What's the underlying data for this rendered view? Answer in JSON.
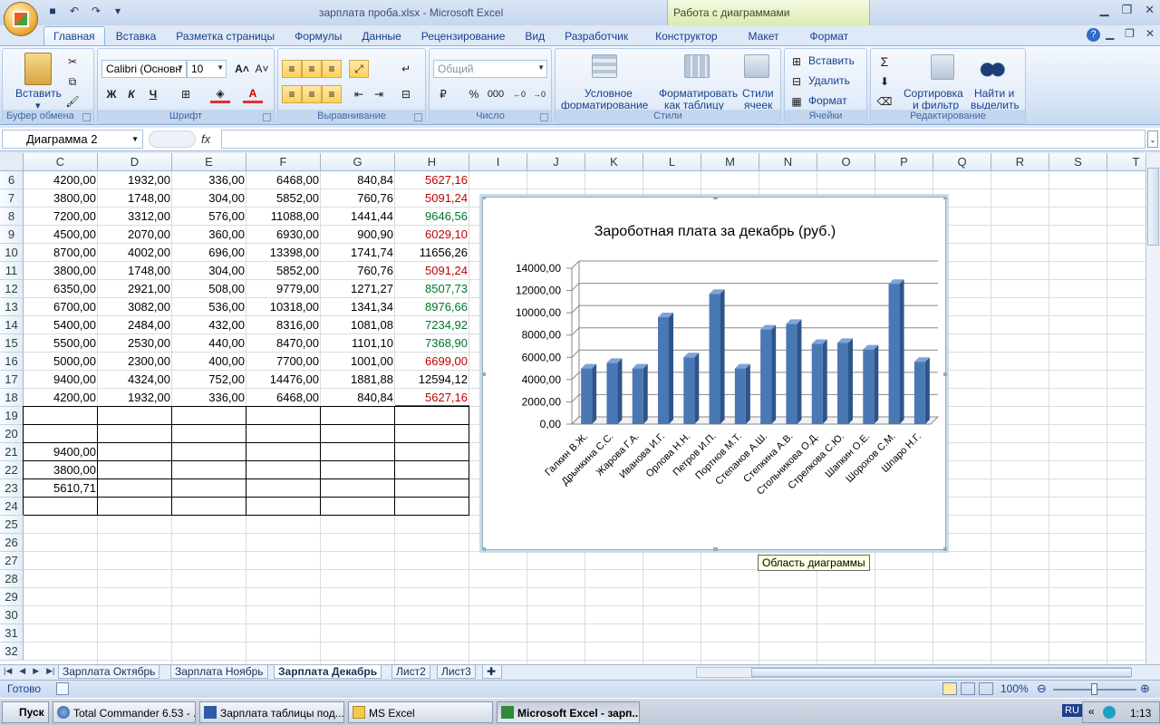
{
  "window": {
    "title": "зарплата проба.xlsx - Microsoft Excel",
    "context_tab_group": "Работа с диаграммами"
  },
  "tabs": [
    "Главная",
    "Вставка",
    "Разметка страницы",
    "Формулы",
    "Данные",
    "Рецензирование",
    "Вид",
    "Разработчик",
    "Конструктор",
    "Макет",
    "Формат"
  ],
  "ribbon": {
    "clipboard": {
      "paste": "Вставить",
      "label": "Буфер обмена"
    },
    "font": {
      "name": "Calibri (Основн",
      "size": "10",
      "label": "Шрифт",
      "bold": "Ж",
      "italic": "К",
      "underline": "Ч"
    },
    "alignment": {
      "label": "Выравнивание"
    },
    "number": {
      "format": "Общий",
      "label": "Число",
      "percent": "%",
      "thousands": "000"
    },
    "styles": {
      "cond1": "Условное",
      "cond2": "форматирование",
      "table1": "Форматировать",
      "table2": "как таблицу",
      "cell1": "Стили",
      "cell2": "ячеек",
      "label": "Стили"
    },
    "cells": {
      "insert": "Вставить",
      "delete": "Удалить",
      "format": "Формат",
      "label": "Ячейки"
    },
    "editing": {
      "sort1": "Сортировка",
      "sort2": "и фильтр",
      "find1": "Найти и",
      "find2": "выделить",
      "label": "Редактирование"
    }
  },
  "formula_bar": {
    "name_box": "Диаграмма 2",
    "fx": "fx"
  },
  "columns": [
    "C",
    "D",
    "E",
    "F",
    "G",
    "H",
    "I",
    "J",
    "K",
    "L",
    "M",
    "N",
    "O",
    "P",
    "Q",
    "R",
    "S",
    "T"
  ],
  "rows": [
    "6",
    "7",
    "8",
    "9",
    "10",
    "11",
    "12",
    "13",
    "14",
    "15",
    "16",
    "17",
    "18",
    "19",
    "20",
    "21",
    "22",
    "23",
    "24",
    "25",
    "26",
    "27",
    "28",
    "29",
    "30",
    "31",
    "32"
  ],
  "table": [
    [
      "4200,00",
      "1932,00",
      "336,00",
      "6468,00",
      "840,84",
      "5627,16"
    ],
    [
      "3800,00",
      "1748,00",
      "304,00",
      "5852,00",
      "760,76",
      "5091,24"
    ],
    [
      "7200,00",
      "3312,00",
      "576,00",
      "11088,00",
      "1441,44",
      "9646,56"
    ],
    [
      "4500,00",
      "2070,00",
      "360,00",
      "6930,00",
      "900,90",
      "6029,10"
    ],
    [
      "8700,00",
      "4002,00",
      "696,00",
      "13398,00",
      "1741,74",
      "11656,26"
    ],
    [
      "3800,00",
      "1748,00",
      "304,00",
      "5852,00",
      "760,76",
      "5091,24"
    ],
    [
      "6350,00",
      "2921,00",
      "508,00",
      "9779,00",
      "1271,27",
      "8507,73"
    ],
    [
      "6700,00",
      "3082,00",
      "536,00",
      "10318,00",
      "1341,34",
      "8976,66"
    ],
    [
      "5400,00",
      "2484,00",
      "432,00",
      "8316,00",
      "1081,08",
      "7234,92"
    ],
    [
      "5500,00",
      "2530,00",
      "440,00",
      "8470,00",
      "1101,10",
      "7368,90"
    ],
    [
      "5000,00",
      "2300,00",
      "400,00",
      "7700,00",
      "1001,00",
      "6699,00"
    ],
    [
      "9400,00",
      "4324,00",
      "752,00",
      "14476,00",
      "1881,88",
      "12594,12"
    ],
    [
      "4200,00",
      "1932,00",
      "336,00",
      "6468,00",
      "840,84",
      "5627,16"
    ]
  ],
  "h_colors": [
    "red",
    "red",
    "green",
    "red",
    "blue",
    "red",
    "green",
    "green",
    "green",
    "green",
    "red",
    "blue",
    "red"
  ],
  "stats": [
    "9400,00",
    "3800,00",
    "5610,71"
  ],
  "chart_data": {
    "type": "bar",
    "title": "Зароботная плата за декабрь (руб.)",
    "categories": [
      "Галкин В.Ж.",
      "Дрынкина С.С.",
      "Жарова Г.А.",
      "Иванова И.Г.",
      "Орлова Н.Н.",
      "Петров И.П.",
      "Портнов М.Т.",
      "Степанов А.Ш.",
      "Степкина А.В.",
      "Стольникова О.Д.",
      "Стрелкова С.Ю.",
      "Шапкин О.Е.",
      "Шорохов С.М.",
      "Шпаро Н.Г."
    ],
    "values": [
      5000,
      5500,
      5000,
      9600,
      6000,
      11700,
      5000,
      8500,
      9000,
      7200,
      7300,
      6700,
      12600,
      5600
    ],
    "yticks": [
      "0,00",
      "2000,00",
      "4000,00",
      "6000,00",
      "8000,00",
      "10000,00",
      "12000,00",
      "14000,00"
    ],
    "ylim": [
      0,
      14000
    ],
    "grid": true,
    "bar_color": "#4a78b5"
  },
  "tooltip": "Область диаграммы",
  "sheets": [
    "Зарплата Октябрь",
    "Зарплата Ноябрь",
    "Зарплата Декабрь",
    "Лист2",
    "Лист3"
  ],
  "status": {
    "ready": "Готово",
    "zoom": "100%"
  },
  "taskbar": {
    "start": "Пуск",
    "tasks": [
      "Total Commander 6.53 - ...",
      "Зарплата таблицы под...",
      "MS Excel",
      "Microsoft Excel - зарп..."
    ],
    "lang": "RU",
    "time": "1:13"
  }
}
